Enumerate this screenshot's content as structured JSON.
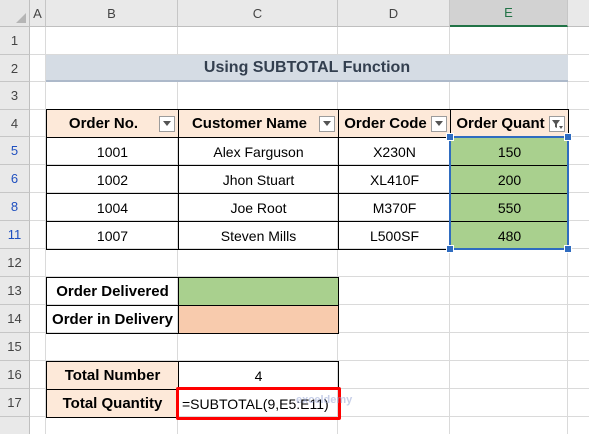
{
  "columns": [
    "A",
    "B",
    "C",
    "D",
    "E"
  ],
  "rows": [
    "1",
    "2",
    "3",
    "4",
    "5",
    "6",
    "8",
    "11",
    "12",
    "13",
    "14",
    "15",
    "16",
    "17"
  ],
  "title": "Using SUBTOTAL Function",
  "table": {
    "headers": [
      "Order No.",
      "Customer Name",
      "Order Code",
      "Order Quant"
    ],
    "rows": [
      [
        "1001",
        "Alex Farguson",
        "X230N",
        "150"
      ],
      [
        "1002",
        "Jhon Stuart",
        "XL410F",
        "200"
      ],
      [
        "1004",
        "Joe Root",
        "M370F",
        "550"
      ],
      [
        "1007",
        "Steven Mills",
        "L500SF",
        "480"
      ]
    ]
  },
  "legend": {
    "delivered": "Order Delivered",
    "in_delivery": "Order in Delivery"
  },
  "summary": {
    "total_number_label": "Total Number",
    "total_number_value": "4",
    "total_quantity_label": "Total Quantity",
    "total_quantity_formula": "=SUBTOTAL(9,E5:E11)"
  },
  "watermark": "exceldemy",
  "colors": {
    "title_bg": "#d5dce4",
    "header_bg": "#fde9d9",
    "delivered": "#a9d08e",
    "in_delivery": "#f8cbad",
    "highlight_box": "#ff0000",
    "selection": "#2f6cc0"
  }
}
